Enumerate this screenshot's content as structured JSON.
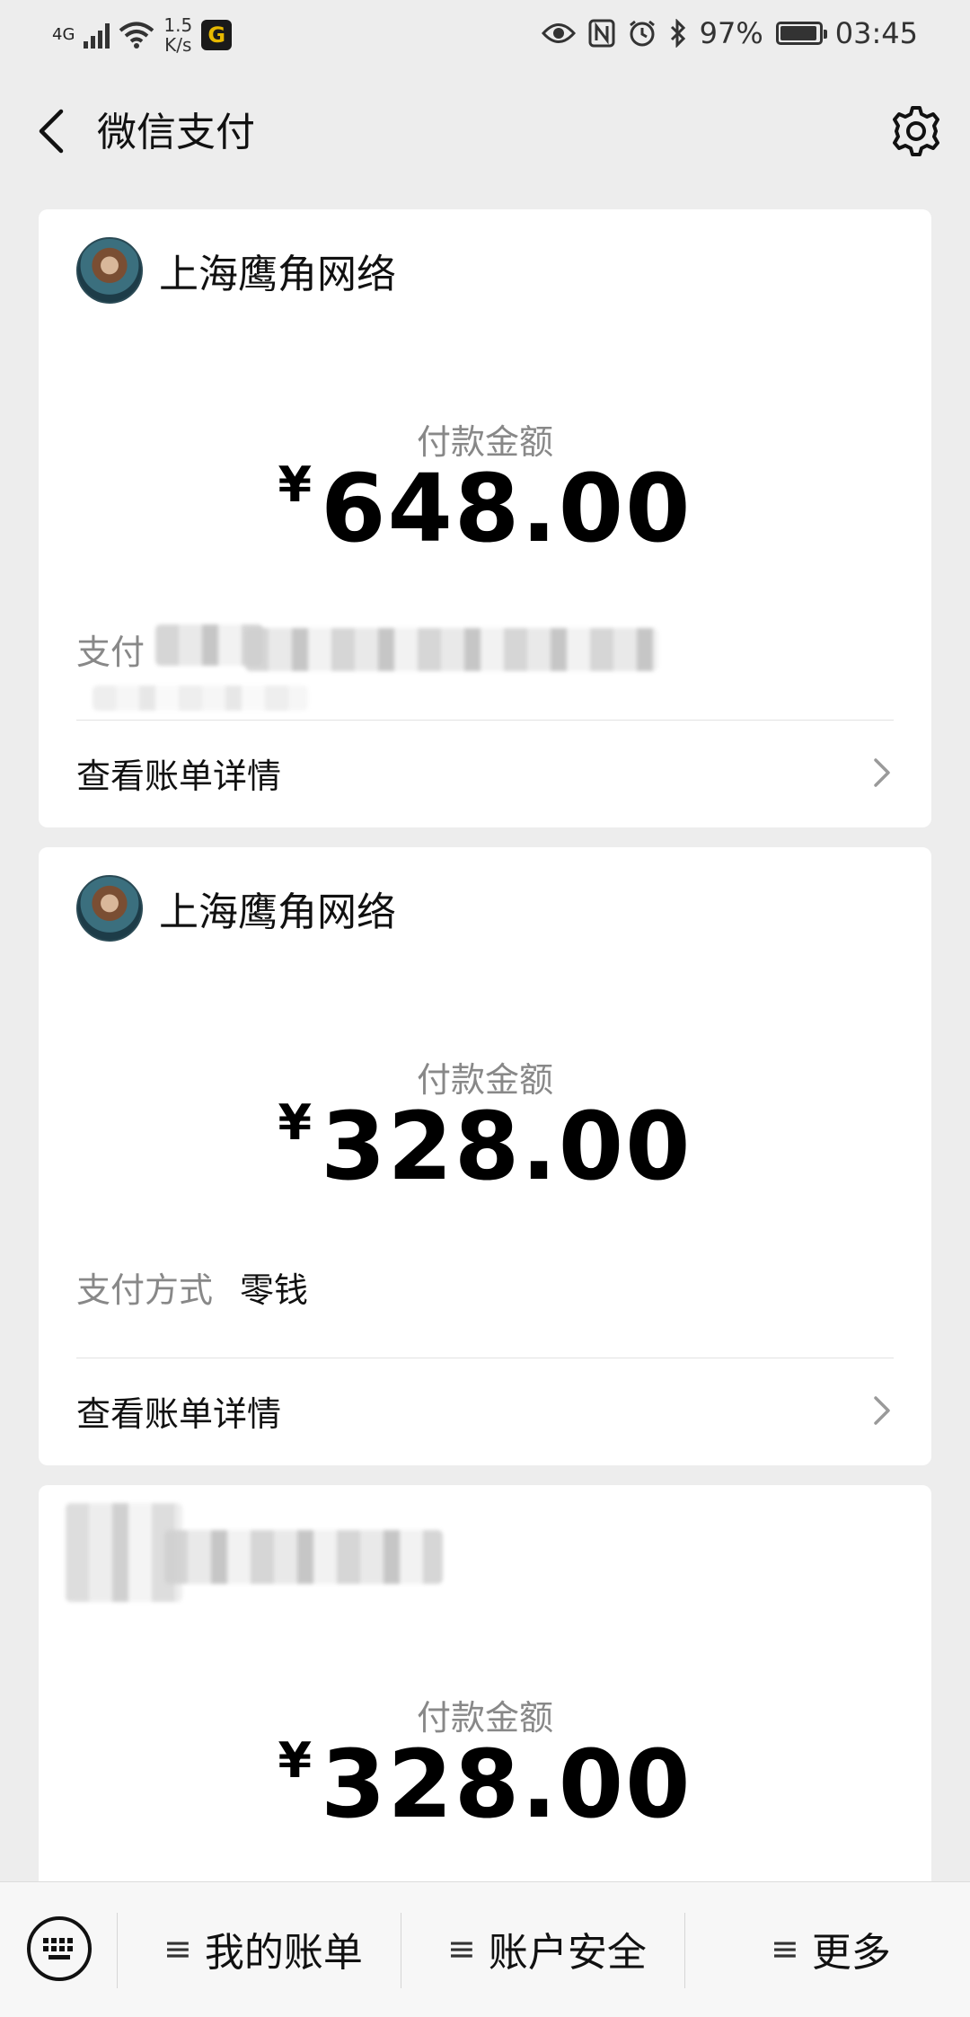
{
  "status_bar": {
    "network": "4G",
    "speed_value": "1.5",
    "speed_unit": "K/s",
    "app_icon": "G",
    "battery": "97%",
    "time": "03:45"
  },
  "nav": {
    "title": "微信支付"
  },
  "cards": [
    {
      "merchant": "上海鹰角网络",
      "amount_label": "付款金额",
      "currency": "¥",
      "amount": "648.00",
      "payment_label": "支付",
      "payment_value": "",
      "detail": "查看账单详情"
    },
    {
      "merchant": "上海鹰角网络",
      "amount_label": "付款金额",
      "currency": "¥",
      "amount": "328.00",
      "payment_label": "支付方式",
      "payment_value": "零钱",
      "detail": "查看账单详情"
    },
    {
      "merchant": "",
      "amount_label": "付款金额",
      "currency": "¥",
      "amount": "328.00"
    }
  ],
  "tabbar": {
    "my_bills": "我的账单",
    "account_security": "账户安全",
    "more": "更多"
  },
  "colors": {
    "background": "#ededed",
    "card": "#ffffff",
    "muted_text": "#888888"
  }
}
